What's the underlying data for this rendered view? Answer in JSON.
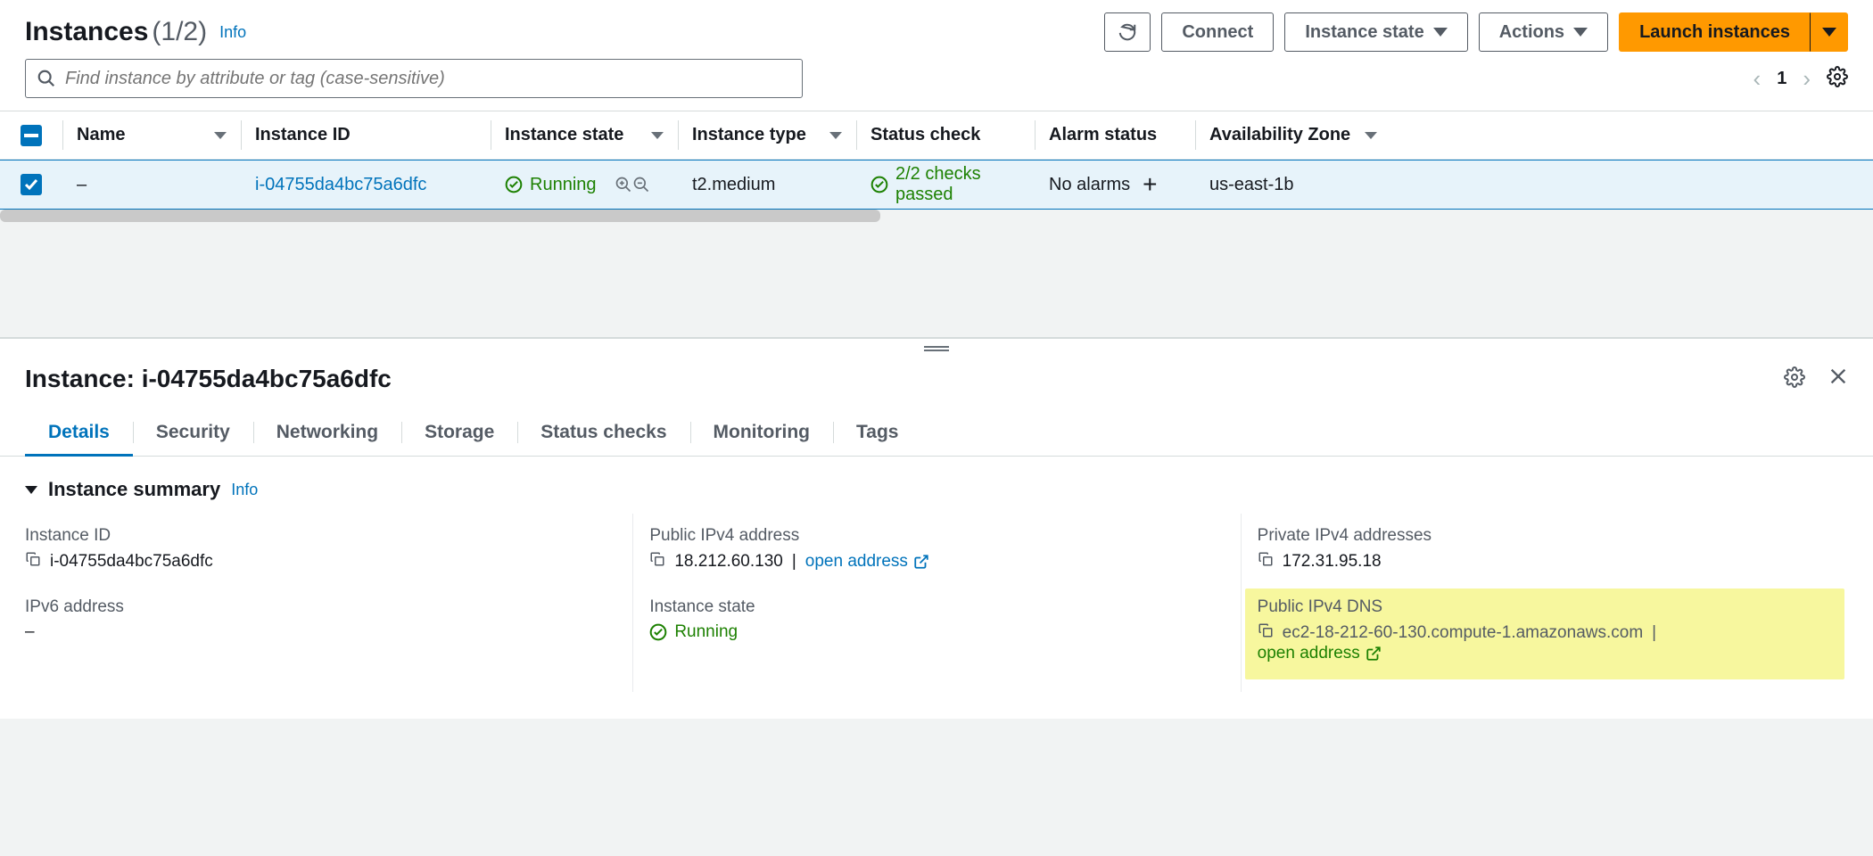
{
  "header": {
    "title": "Instances",
    "count": "(1/2)",
    "info": "Info",
    "refresh_label": "",
    "connect_label": "Connect",
    "instance_state_label": "Instance state",
    "actions_label": "Actions",
    "launch_label": "Launch instances"
  },
  "search": {
    "placeholder": "Find instance by attribute or tag (case-sensitive)"
  },
  "pagination": {
    "page": "1"
  },
  "columns": {
    "name": "Name",
    "instance_id": "Instance ID",
    "instance_state": "Instance state",
    "instance_type": "Instance type",
    "status_check": "Status check",
    "alarm_status": "Alarm status",
    "az": "Availability Zone"
  },
  "rows": [
    {
      "name": "–",
      "instance_id": "i-04755da4bc75a6dfc",
      "state": "Running",
      "type": "t2.medium",
      "status": "2/2 checks passed",
      "alarm": "No alarms",
      "az": "us-east-1b"
    }
  ],
  "detail": {
    "title_prefix": "Instance: ",
    "title_id": "i-04755da4bc75a6dfc",
    "tabs": {
      "details": "Details",
      "security": "Security",
      "networking": "Networking",
      "storage": "Storage",
      "status_checks": "Status checks",
      "monitoring": "Monitoring",
      "tags": "Tags"
    },
    "summary": {
      "heading": "Instance summary",
      "info": "Info",
      "instance_id_label": "Instance ID",
      "instance_id_value": "i-04755da4bc75a6dfc",
      "public_ipv4_label": "Public IPv4 address",
      "public_ipv4_value": "18.212.60.130",
      "open_address": "open address",
      "private_ipv4_label": "Private IPv4 addresses",
      "private_ipv4_value": "172.31.95.18",
      "ipv6_label": "IPv6 address",
      "ipv6_value": "–",
      "instance_state_label": "Instance state",
      "instance_state_value": "Running",
      "public_dns_label": "Public IPv4 DNS",
      "public_dns_value": "ec2-18-212-60-130.compute-1.amazonaws.com"
    }
  }
}
